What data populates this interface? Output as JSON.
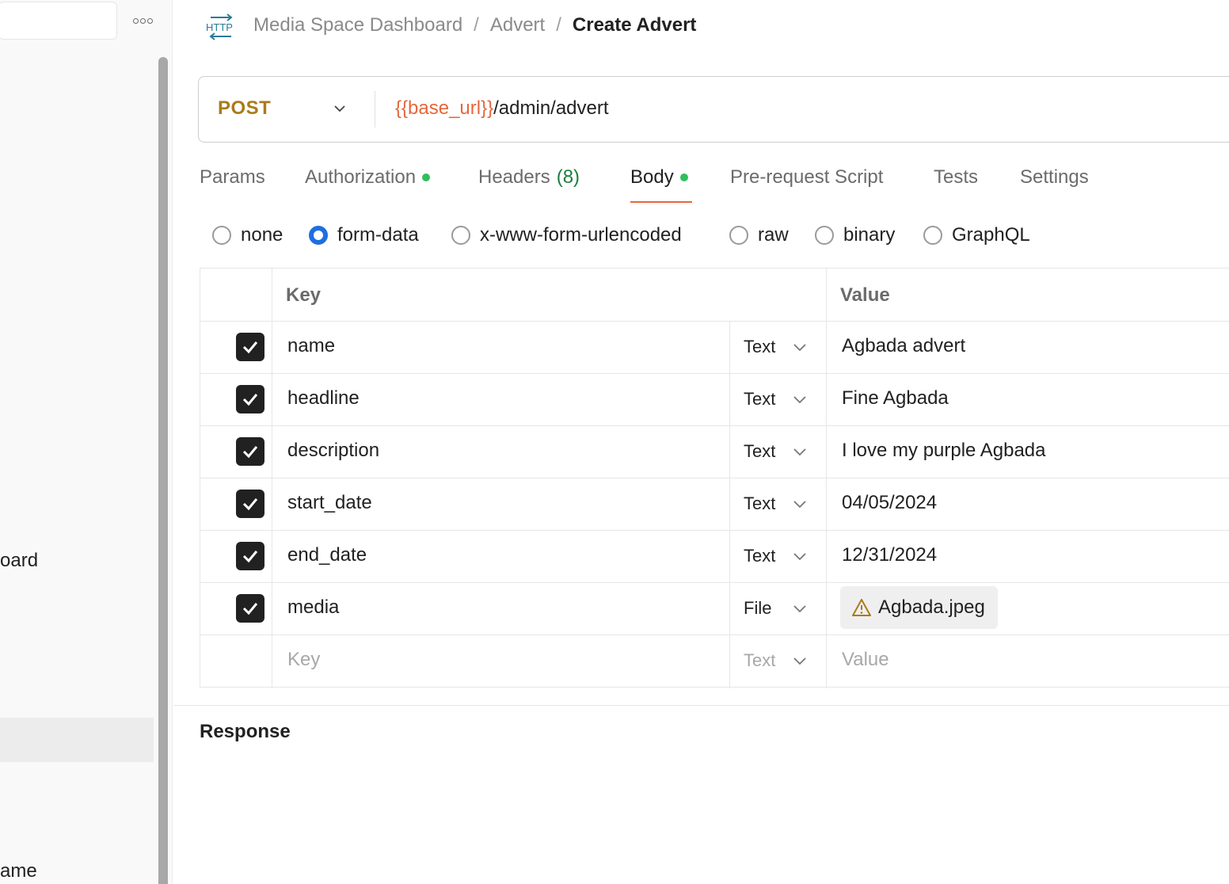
{
  "sidebar": {
    "more_icon": "more-horizontal-icon",
    "partial_items": [
      "oard",
      "ame"
    ]
  },
  "breadcrumb": {
    "icon": "http-icon",
    "items": [
      "Media Space Dashboard",
      "Advert"
    ],
    "separator": "/",
    "current": "Create Advert"
  },
  "request": {
    "method": "POST",
    "url_variable": "{{base_url}}",
    "url_path": "/admin/advert"
  },
  "tabs": {
    "params": "Params",
    "authorization": "Authorization",
    "headers": "Headers",
    "headers_count": "(8)",
    "body": "Body",
    "pre_request": "Pre-request Script",
    "tests": "Tests",
    "settings": "Settings",
    "active": "Body"
  },
  "body_types": {
    "none": "none",
    "form_data": "form-data",
    "urlencoded": "x-www-form-urlencoded",
    "raw": "raw",
    "binary": "binary",
    "graphql": "GraphQL",
    "selected": "form-data"
  },
  "table": {
    "key_header": "Key",
    "value_header": "Value",
    "rows": [
      {
        "key": "name",
        "type": "Text",
        "value": "Agbada advert",
        "checked": true
      },
      {
        "key": "headline",
        "type": "Text",
        "value": "Fine Agbada",
        "checked": true
      },
      {
        "key": "description",
        "type": "Text",
        "value": "I love my purple Agbada",
        "checked": true
      },
      {
        "key": "start_date",
        "type": "Text",
        "value": "04/05/2024",
        "checked": true
      },
      {
        "key": "end_date",
        "type": "Text",
        "value": "12/31/2024",
        "checked": true
      },
      {
        "key": "media",
        "type": "File",
        "value": "Agbada.jpeg",
        "checked": true,
        "warning_icon": "warning-icon"
      }
    ],
    "new_row": {
      "key_placeholder": "Key",
      "type": "Text",
      "value_placeholder": "Value"
    }
  },
  "response": {
    "title": "Response"
  },
  "colors": {
    "method": "#a97b1b",
    "url_variable": "#e5683c",
    "active_tab_underline": "#e5683c",
    "status_dot": "#2fbf5b",
    "radio_selected": "#1d6fe0"
  }
}
